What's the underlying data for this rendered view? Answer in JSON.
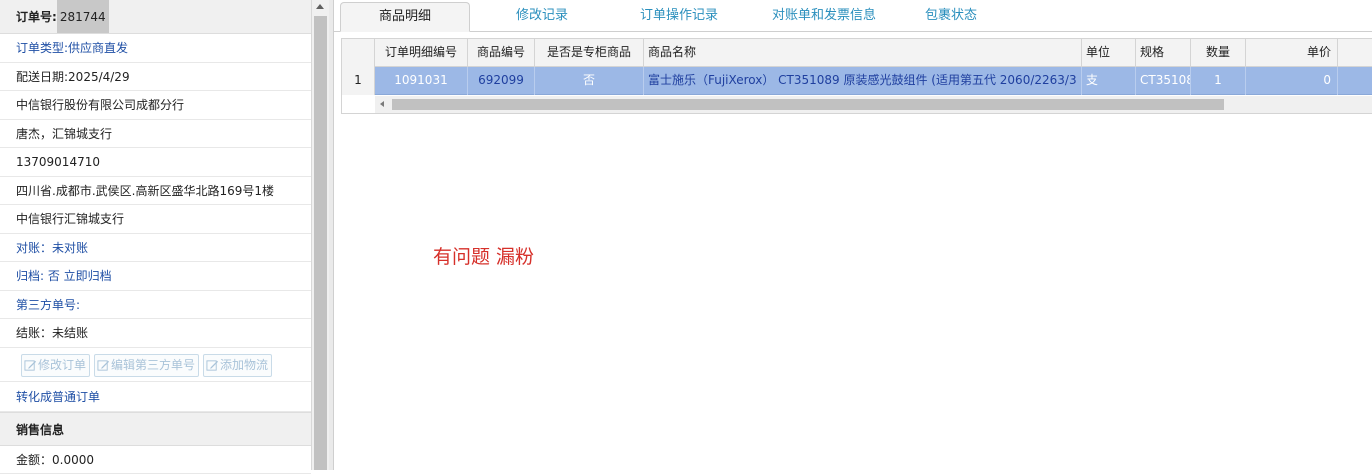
{
  "order": {
    "no_label": "订单号:",
    "no_value": "281744",
    "type": "订单类型:供应商直发",
    "delivery_date": "配送日期:2025/4/29",
    "company": "中信银行股份有限公司成都分行",
    "contact": "唐杰，汇锦城支行",
    "phone": "13709014710",
    "address": "四川省.成都市.武侯区.高新区盛华北路169号1楼",
    "branch": "中信银行汇锦城支行",
    "reconcile": "对账：未对账",
    "archive": "归档:  否 立即归档",
    "third_party_no": "第三方单号:",
    "settlement": "结账：未结账",
    "actions": {
      "edit_order": "修改订单",
      "edit_third_party": "编辑第三方单号",
      "add_logistics": "添加物流"
    },
    "convert": "转化成普通订单",
    "sales_section": "销售信息",
    "amount": "金额：0.0000"
  },
  "tabs": [
    {
      "label": "商品明细",
      "active": true
    },
    {
      "label": "修改记录"
    },
    {
      "label": "订单操作记录"
    },
    {
      "label": "对账单和发票信息"
    },
    {
      "label": "包裹状态"
    }
  ],
  "grid": {
    "headers": {
      "detail_no": "订单明细编号",
      "product_no": "商品编号",
      "is_counter": "是否是专柜商品",
      "product_name": "商品名称",
      "unit": "单位",
      "spec": "规格",
      "qty": "数量",
      "price": "单价"
    },
    "rows": [
      {
        "rownum": "1",
        "detail_no": "1091031",
        "product_no": "692099",
        "is_counter": "否",
        "product_name": "富士施乐（FujiXerox） CT351089 原装感光鼓组件 (适用第五代 2060/2263/3",
        "unit": "支",
        "spec": "CT35108",
        "qty": "1",
        "price": "0"
      }
    ]
  },
  "note": "有问题 漏粉",
  "colors": {
    "link_blue": "#1f4fa5",
    "tab_blue": "#2a8fbd",
    "row_selected": "#9cb8e6",
    "note_red": "#d6302a"
  }
}
